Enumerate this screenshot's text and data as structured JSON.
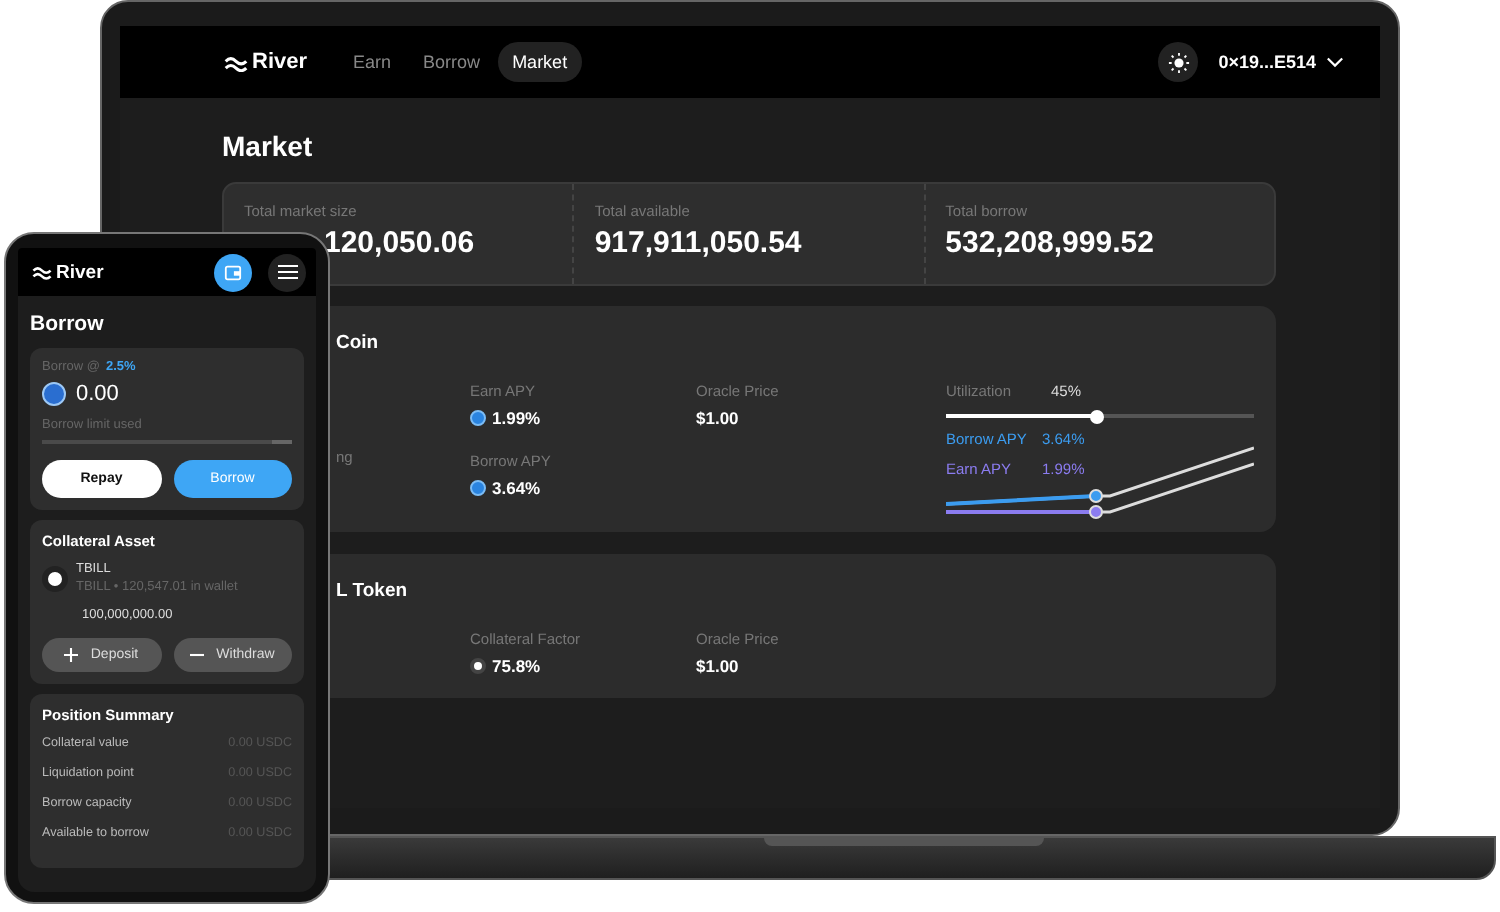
{
  "laptop": {
    "nav": {
      "brand": "River",
      "tabs": [
        {
          "label": "Earn",
          "selected": false
        },
        {
          "label": "Borrow",
          "selected": false
        },
        {
          "label": "Market",
          "selected": true
        }
      ],
      "account": "0×19...E514"
    },
    "title": "Market",
    "stats": [
      {
        "label": "Total market size",
        "value": "120,050.06"
      },
      {
        "label": "Total available",
        "value": "917,911,050.54"
      },
      {
        "label": "Total borrow",
        "value": "532,208,999.52"
      }
    ],
    "markets": [
      {
        "kind": "loan",
        "title": "Coin",
        "side_label": "ng",
        "earn_label": "Earn APY",
        "earn_value": "1.99%",
        "borrow_label": "Borrow APY",
        "borrow_value": "3.64%",
        "price_label": "Oracle Price",
        "price_value": "$1.00",
        "utilization_label": "Utilization",
        "utilization_value": "45%",
        "level": 0.49,
        "legend": [
          {
            "label": "Borrow APY",
            "value": "3.64%",
            "color": "#3b9cf0"
          },
          {
            "label": "Earn APY",
            "value": "1.99%",
            "color": "#8b7cf0"
          }
        ]
      },
      {
        "kind": "collateral",
        "title": "L Token",
        "factor_label": "Collateral Factor",
        "factor_value": "75.8%",
        "price_label": "Oracle Price",
        "price_value": "$1.00"
      }
    ]
  },
  "phone": {
    "brand": "River",
    "title": "Borrow",
    "borrow": {
      "label": "Borrow @",
      "rate": "2.5%",
      "amount": "0.00",
      "limit_label": "Borrow limit used",
      "level": 0.92,
      "buttons": [
        "Repay",
        "Borrow"
      ]
    },
    "collateral": {
      "title": "Collateral Asset",
      "asset": "TBILL",
      "wallet": "TBILL • 120,547.01 in wallet",
      "amount": "100,000,000.00",
      "buttons": [
        "Deposit",
        "Withdraw"
      ]
    },
    "summary": {
      "title": "Position Summary",
      "rows": [
        {
          "label": "Collateral value",
          "value": "0.00 USDC"
        },
        {
          "label": "Liquidation point",
          "value": "0.00 USDC"
        },
        {
          "label": "Borrow capacity",
          "value": "0.00 USDC"
        },
        {
          "label": "Available to borrow",
          "value": "0.00 USDC"
        }
      ]
    }
  }
}
